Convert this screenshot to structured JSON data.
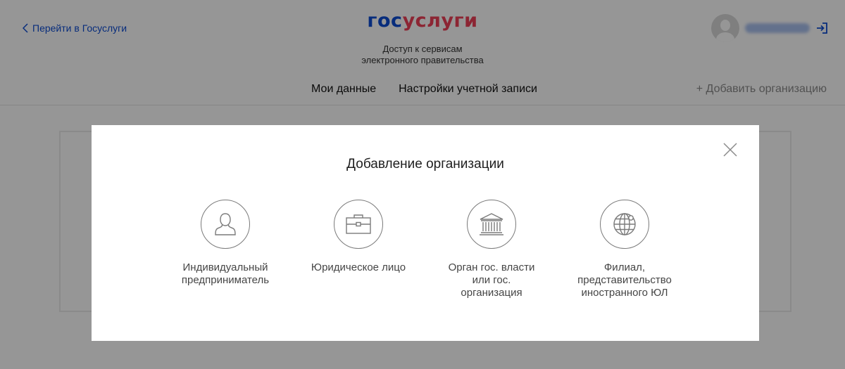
{
  "header": {
    "back_link": "Перейти в Госуслуги",
    "logo_part1": "гос",
    "logo_part2": "услуги",
    "subtitle_line1": "Доступ к сервисам",
    "subtitle_line2": "электронного правительства",
    "user_name_blurred": true,
    "icons": {
      "back": "chevron-left-icon",
      "avatar": "user-avatar-icon",
      "logout": "logout-icon"
    }
  },
  "nav": {
    "items": [
      "Мои данные",
      "Настройки учетной записи"
    ],
    "add_org": "+ Добавить организацию"
  },
  "modal": {
    "title": "Добавление организации",
    "close_icon": "close-icon",
    "options": [
      {
        "label_lines": [
          "Индивидуальный",
          "предприниматель"
        ],
        "icon": "person-icon"
      },
      {
        "label_lines": [
          "Юридическое лицо"
        ],
        "icon": "briefcase-icon"
      },
      {
        "label_lines": [
          "Орган гос. власти",
          "или гос.",
          "организация"
        ],
        "icon": "government-building-icon"
      },
      {
        "label_lines": [
          "Филиал,",
          "представительство",
          "иностранного ЮЛ"
        ],
        "icon": "globe-icon"
      }
    ]
  },
  "colors": {
    "brand_blue": "#0d4cd3",
    "brand_red": "#ee3f58",
    "overlay": "rgba(0,0,0,0.41)",
    "icon_gray": "#7a7a7a"
  }
}
